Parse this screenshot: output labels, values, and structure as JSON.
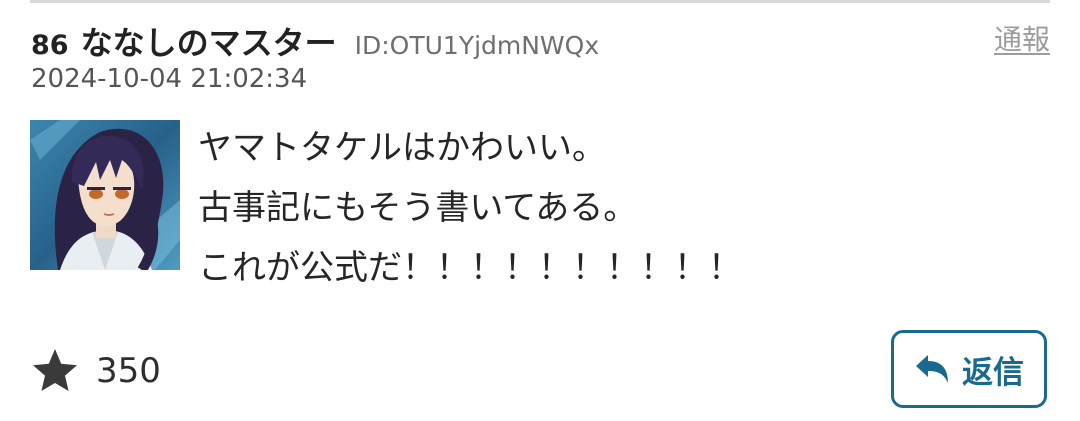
{
  "post": {
    "number": "86",
    "name": "ななしのマスター",
    "id_label": "ID:OTU1YjdmNWQx",
    "report_label": "通報",
    "timestamp": "2024-10-04 21:02:34",
    "message_lines": [
      "ヤマトタケルはかわいい。",
      "古事記にもそう書いてある。",
      "これが公式だ！！！！！！！！！！"
    ],
    "like_count": "350",
    "reply_label": "返信"
  },
  "icons": {
    "like": "star-icon",
    "reply": "reply-arrow-icon"
  },
  "colors": {
    "accent": "#1a6a8e",
    "report_link": "#9c9c9c",
    "divider": "#d9d9d9",
    "avatar_bg": "#2f6d94"
  }
}
